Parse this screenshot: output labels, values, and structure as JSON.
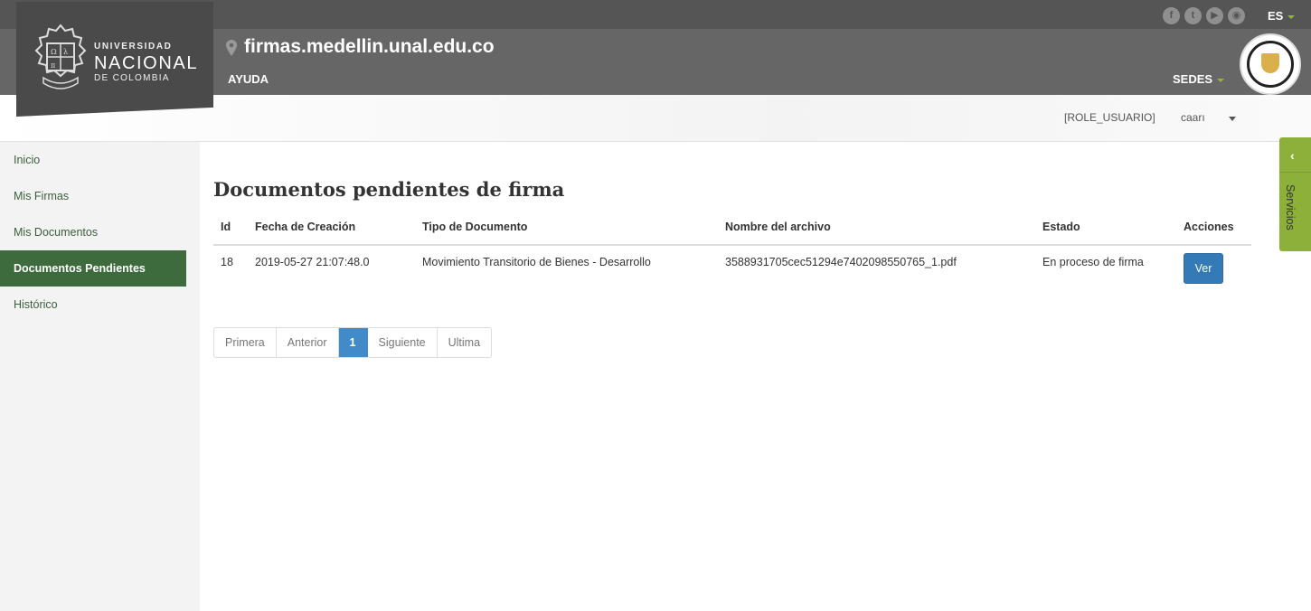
{
  "header": {
    "university_line1": "UNIVERSIDAD",
    "university_line2": "NACIONAL",
    "university_line3": "DE COLOMBIA",
    "site_title": "firmas.medellin.unal.edu.co",
    "help_label": "AYUDA",
    "sedes_label": "SEDES",
    "lang_label": "ES",
    "social_icons": [
      "facebook-icon",
      "twitter-icon",
      "youtube-icon",
      "rss-icon"
    ],
    "accent_color": "#94b43b"
  },
  "userbar": {
    "role": "[ROLE_USUARIO]",
    "user": "caarı"
  },
  "sidebar": {
    "items": [
      {
        "label": "Inicio",
        "active": false
      },
      {
        "label": "Mis Firmas",
        "active": false
      },
      {
        "label": "Mis Documentos",
        "active": false
      },
      {
        "label": "Documentos Pendientes",
        "active": true
      },
      {
        "label": "Histórico",
        "active": false
      }
    ],
    "active_color": "#3e6b3e"
  },
  "main": {
    "title": "Documentos pendientes de firma",
    "table": {
      "headers": [
        "Id",
        "Fecha de Creación",
        "Tipo de Documento",
        "Nombre del archivo",
        "Estado",
        "Acciones"
      ],
      "rows": [
        {
          "id": "18",
          "fecha": "2019-05-27 21:07:48.0",
          "tipo": "Movimiento Transitorio de Bienes - Desarrollo",
          "archivo": "3588931705cec51294e7402098550765_1.pdf",
          "estado": "En proceso de firma",
          "action_label": "Ver"
        }
      ]
    },
    "pagination": {
      "first": "Primera",
      "prev": "Anterior",
      "current": "1",
      "next": "Siguiente",
      "last": "Ultima"
    }
  },
  "services": {
    "label": "Servicios",
    "color": "#8cb03a"
  }
}
